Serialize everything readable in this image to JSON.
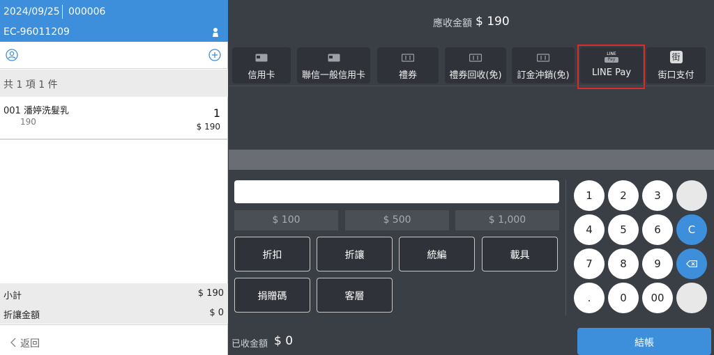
{
  "header": {
    "date": "2024/09/25",
    "order_no": "000006",
    "invoice_no": "EC-96011209"
  },
  "summary": "共 1 項 1 件",
  "items": [
    {
      "code_name": "001 潘婷洗髮乳",
      "unit_price": "190",
      "qty": "1",
      "amount": "$ 190"
    }
  ],
  "totals": {
    "subtotal_label": "小計",
    "subtotal": "$ 190",
    "discount_label": "折讓金額",
    "discount": "$ 0"
  },
  "back_label": "返回",
  "due": {
    "label": "應收金額",
    "amount": "$ 190"
  },
  "payment_types": [
    {
      "label": "信用卡",
      "icon": "card-icon"
    },
    {
      "label": "聯信一般信用卡",
      "icon": "card-icon"
    },
    {
      "label": "禮券",
      "icon": "voucher-icon"
    },
    {
      "label": "禮券回收(免)",
      "icon": "voucher-icon"
    },
    {
      "label": "訂金沖銷(免)",
      "icon": "voucher-icon"
    },
    {
      "label": "LINE Pay",
      "icon": "linepay-icon",
      "logo_top": "LINE",
      "logo_bottom": "Pay"
    },
    {
      "label": "街口支付",
      "icon": "jkopay-icon",
      "logo": "街"
    }
  ],
  "amount_input": {
    "value": "",
    "placeholder": ""
  },
  "quick_amounts": [
    "$ 100",
    "$ 500",
    "$ 1,000"
  ],
  "actions": [
    "折扣",
    "折讓",
    "統編",
    "載具",
    "捐贈碼",
    "客層"
  ],
  "keypad": {
    "row1": [
      "1",
      "2",
      "3",
      ""
    ],
    "row2": [
      "4",
      "5",
      "6",
      "C"
    ],
    "row3": [
      "7",
      "8",
      "9",
      "⌫"
    ],
    "row4": [
      ".",
      "0",
      "00",
      ""
    ]
  },
  "received": {
    "label": "已收金額",
    "amount": "$ 0"
  },
  "checkout_label": "結帳",
  "colors": {
    "accent": "#3d8fdc",
    "panel": "#3a3e45",
    "button": "#2f3238",
    "highlight": "#dc2b2b"
  }
}
